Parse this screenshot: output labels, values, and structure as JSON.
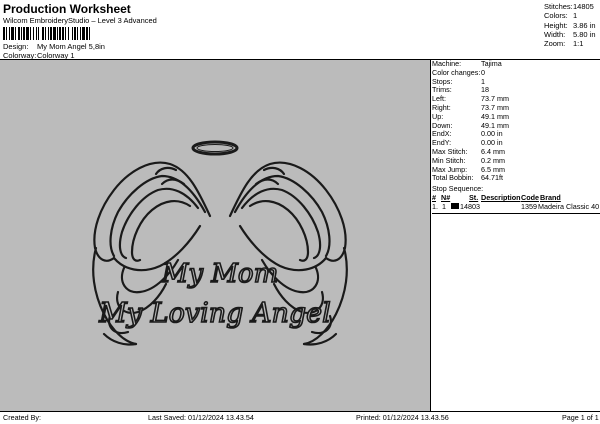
{
  "header": {
    "title": "Production Worksheet",
    "subtitle": "Wilcom EmbroideryStudio – Level 3 Advanced"
  },
  "summary": [
    {
      "label": "Stitches:",
      "value": "14805"
    },
    {
      "label": "Colors:",
      "value": "1"
    },
    {
      "label": "Height:",
      "value": "3.86 in"
    },
    {
      "label": "Width:",
      "value": "5.80 in"
    },
    {
      "label": "Zoom:",
      "value": "1:1"
    }
  ],
  "design": {
    "design_label": "Design:",
    "design_value": "My Mom Angel 5,8in",
    "colorway_label": "Colorway:",
    "colorway_value": "Colorway 1"
  },
  "preview": {
    "line1": "My Mom",
    "line2": "My Loving Angel"
  },
  "details": [
    {
      "label": "Machine:",
      "value": "Tajima"
    },
    {
      "label": "Color changes:",
      "value": "0"
    },
    {
      "label": "Stops:",
      "value": "1"
    },
    {
      "label": "Trims:",
      "value": "18"
    },
    {
      "label": "Left:",
      "value": "73.7 mm"
    },
    {
      "label": "Right:",
      "value": "73.7 mm"
    },
    {
      "label": "Up:",
      "value": "49.1 mm"
    },
    {
      "label": "Down:",
      "value": "49.1 mm"
    },
    {
      "label": "EndX:",
      "value": "0.00 in"
    },
    {
      "label": "EndY:",
      "value": "0.00 in"
    },
    {
      "label": "Max Stitch:",
      "value": "6.4 mm"
    },
    {
      "label": "Min Stitch:",
      "value": "0.2 mm"
    },
    {
      "label": "Max Jump:",
      "value": "6.5 mm"
    },
    {
      "label": "Total Bobbin:",
      "value": "64.71ft"
    }
  ],
  "stop_sequence": {
    "title": "Stop Sequence:",
    "headers": {
      "num": "#",
      "n": "N#",
      "st": "St.",
      "description": "Description",
      "code": "Code",
      "brand": "Brand"
    },
    "rows": [
      {
        "num": "1.",
        "n": "1",
        "swatch_color": "#000000",
        "st": "14803",
        "description": "",
        "code": "1359",
        "brand": "Madeira Classic 40"
      }
    ]
  },
  "footer": {
    "created_by": "Created By:",
    "last_saved": "Last Saved: 01/12/2024 13.43.54",
    "printed": "Printed: 01/12/2024 13.43.56",
    "page": "Page 1 of 1"
  }
}
